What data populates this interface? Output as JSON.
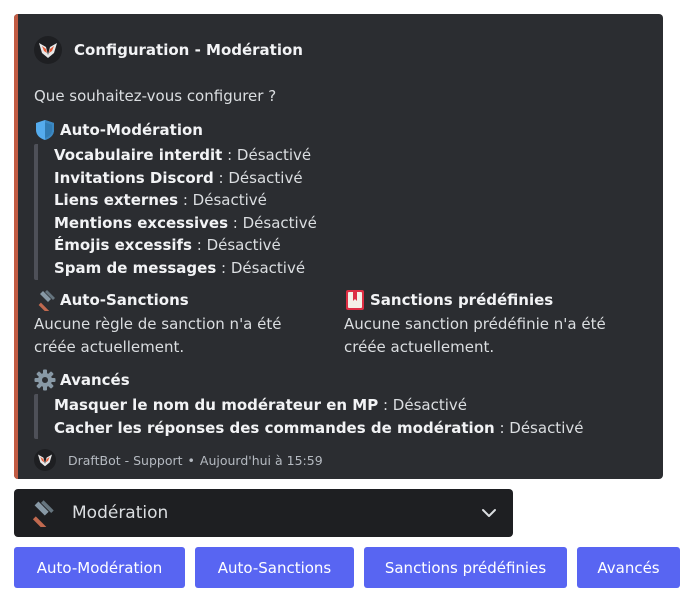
{
  "embed": {
    "author": "Configuration - Modération",
    "description": "Que souhaitez-vous configurer ?",
    "accent_color": "#c15b43",
    "auto_moderation": {
      "title": "Auto-Modération",
      "icon": "shield-icon",
      "items": [
        {
          "name": "Vocabulaire interdit",
          "value": " : Désactivé"
        },
        {
          "name": "Invitations Discord",
          "value": " : Désactivé"
        },
        {
          "name": "Liens externes",
          "value": " : Désactivé"
        },
        {
          "name": "Mentions excessives",
          "value": " : Désactivé"
        },
        {
          "name": "Émojis excessifs",
          "value": " : Désactivé"
        },
        {
          "name": "Spam de messages",
          "value": " : Désactivé"
        }
      ]
    },
    "auto_sanctions": {
      "title": "Auto-Sanctions",
      "icon": "hammer-icon",
      "text": "Aucune règle de sanction n'a été créée actuellement."
    },
    "predefined_sanctions": {
      "title": "Sanctions prédéfinies",
      "icon": "bookmark-book-icon",
      "text": "Aucune sanction prédéfinie n'a été créée actuellement."
    },
    "advanced": {
      "title": "Avancés",
      "icon": "gear-icon",
      "items": [
        {
          "name": "Masquer le nom du modérateur en MP",
          "value": " : Désactivé"
        },
        {
          "name": "Cacher les réponses des commandes de modération",
          "value": " : Désactivé"
        }
      ]
    },
    "footer": {
      "text": "DraftBot - Support",
      "separator": "•",
      "timestamp": "Aujourd'hui à 15:59"
    }
  },
  "select": {
    "icon": "hammer-icon",
    "value": "Modération"
  },
  "buttons": [
    {
      "label": "Auto-Modération"
    },
    {
      "label": "Auto-Sanctions"
    },
    {
      "label": "Sanctions prédéfinies"
    },
    {
      "label": "Avancés"
    }
  ],
  "colors": {
    "button": "#5865f2",
    "embed_bg": "#2b2d31",
    "select_bg": "#1e1f22"
  }
}
